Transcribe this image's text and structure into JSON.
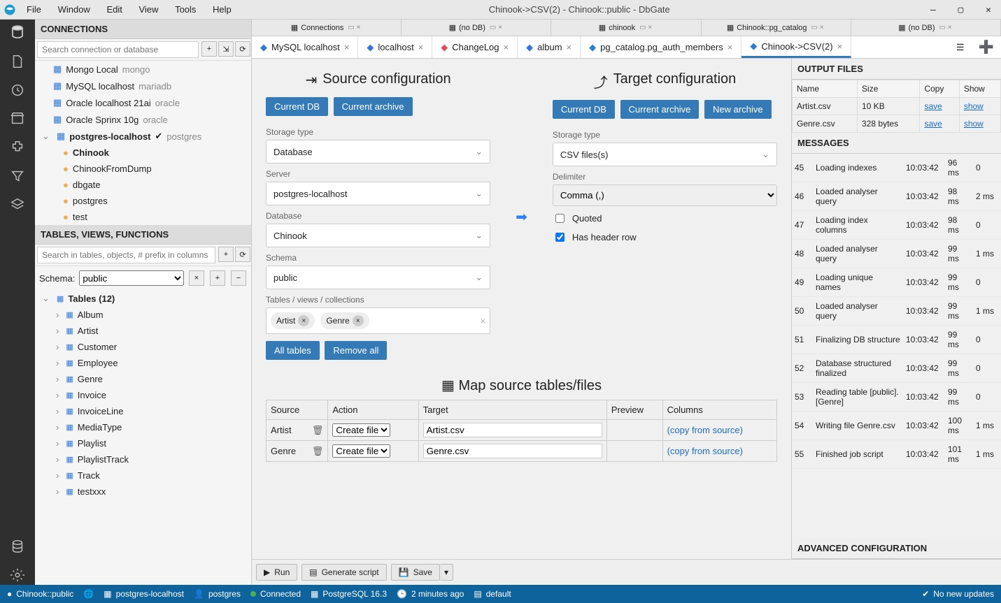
{
  "window": {
    "title": "Chinook->CSV(2) - Chinook::public - DbGate",
    "menu": [
      "File",
      "Window",
      "Edit",
      "View",
      "Tools",
      "Help"
    ]
  },
  "sidebar": {
    "connections_header": "CONNECTIONS",
    "conn_search_placeholder": "Search connection or database",
    "connections": [
      {
        "label": "Mongo Local",
        "engine": "mongo",
        "icon": "db"
      },
      {
        "label": "MySQL localhost",
        "engine": "mariadb",
        "icon": "db"
      },
      {
        "label": "Oracle localhost 21ai",
        "engine": "oracle",
        "icon": "db"
      },
      {
        "label": "Oracle Sprinx 10g",
        "engine": "oracle",
        "icon": "db"
      }
    ],
    "expanded_conn": {
      "label": "postgres-localhost",
      "engine": "postgres",
      "connected": true
    },
    "databases": [
      {
        "label": "Chinook",
        "bold": true
      },
      {
        "label": "ChinookFromDump"
      },
      {
        "label": "dbgate"
      },
      {
        "label": "postgres"
      },
      {
        "label": "test"
      }
    ],
    "tvf_header": "TABLES, VIEWS, FUNCTIONS",
    "tvf_search_placeholder": "Search in tables, objects, # prefix in columns",
    "schema_label": "Schema:",
    "schema_value": "public",
    "tables_header": "Tables (12)",
    "tables": [
      "Album",
      "Artist",
      "Customer",
      "Employee",
      "Genre",
      "Invoice",
      "InvoiceLine",
      "MediaType",
      "Playlist",
      "PlaylistTrack",
      "Track",
      "testxxx"
    ]
  },
  "top_tabs": [
    {
      "label": "Connections",
      "icon": "plug"
    },
    {
      "label": "(no DB)",
      "icon": "db"
    },
    {
      "label": "chinook",
      "icon": "db"
    },
    {
      "label": "Chinook::pg_catalog",
      "icon": "db"
    },
    {
      "label": "(no DB)",
      "icon": "db"
    }
  ],
  "editor_tabs": [
    {
      "label": "MySQL localhost",
      "color": "#2c7ae0",
      "icon": "plug"
    },
    {
      "label": "localhost",
      "color": "#2c7ae0",
      "icon": "plug"
    },
    {
      "label": "ChangeLog",
      "color": "#d9534f",
      "icon": "doc"
    },
    {
      "label": "album",
      "color": "#2c7ae0",
      "icon": "table"
    },
    {
      "label": "pg_catalog.pg_auth_members",
      "color": "#2c7ae0",
      "icon": "table"
    },
    {
      "label": "Chinook->CSV(2)",
      "color": "#2c7ae0",
      "icon": "share",
      "active": true
    }
  ],
  "source": {
    "title": "Source configuration",
    "btn_currentdb": "Current DB",
    "btn_currentarchive": "Current archive",
    "storage_label": "Storage type",
    "storage": "Database",
    "server_label": "Server",
    "server": "postgres-localhost",
    "database_label": "Database",
    "database": "Chinook",
    "schema_label": "Schema",
    "schema": "public",
    "tables_label": "Tables / views / collections",
    "chips": [
      "Artist",
      "Genre"
    ],
    "btn_alltables": "All tables",
    "btn_removeall": "Remove all"
  },
  "target": {
    "title": "Target configuration",
    "btn_currentdb": "Current DB",
    "btn_currentarchive": "Current archive",
    "btn_newarchive": "New archive",
    "storage_label": "Storage type",
    "storage": "CSV files(s)",
    "delimiter_label": "Delimiter",
    "delimiter": "Comma (,)",
    "quoted_label": "Quoted",
    "quoted": false,
    "header_label": "Has header row",
    "header": true
  },
  "map": {
    "title": "Map source tables/files",
    "cols": [
      "Source",
      "Action",
      "Target",
      "Preview",
      "Columns"
    ],
    "action_option": "Create file",
    "copy_text": "(copy from source)",
    "rows": [
      {
        "source": "Artist",
        "target": "Artist.csv"
      },
      {
        "source": "Genre",
        "target": "Genre.csv"
      }
    ]
  },
  "actions": {
    "run": "Run",
    "generate": "Generate script",
    "save": "Save"
  },
  "output": {
    "title": "OUTPUT FILES",
    "cols": {
      "name": "Name",
      "size": "Size",
      "copy": "Copy",
      "show": "Show"
    },
    "rows": [
      {
        "name": "Artist.csv",
        "size": "10 KB",
        "copy": "save",
        "show": "show"
      },
      {
        "name": "Genre.csv",
        "size": "328 bytes",
        "copy": "save",
        "show": "show"
      }
    ]
  },
  "messages": {
    "title": "MESSAGES",
    "rows": [
      {
        "n": "45",
        "msg": "Loading indexes",
        "t": "10:03:42",
        "d": "96 ms",
        "e": "0"
      },
      {
        "n": "46",
        "msg": "Loaded analyser query",
        "t": "10:03:42",
        "d": "98 ms",
        "e": "2 ms"
      },
      {
        "n": "47",
        "msg": "Loading index columns",
        "t": "10:03:42",
        "d": "98 ms",
        "e": "0"
      },
      {
        "n": "48",
        "msg": "Loaded analyser query",
        "t": "10:03:42",
        "d": "99 ms",
        "e": "1 ms"
      },
      {
        "n": "49",
        "msg": "Loading unique names",
        "t": "10:03:42",
        "d": "99 ms",
        "e": "0"
      },
      {
        "n": "50",
        "msg": "Loaded analyser query",
        "t": "10:03:42",
        "d": "99 ms",
        "e": "1 ms"
      },
      {
        "n": "51",
        "msg": "Finalizing DB structure",
        "t": "10:03:42",
        "d": "99 ms",
        "e": "0"
      },
      {
        "n": "52",
        "msg": "Database structured finalized",
        "t": "10:03:42",
        "d": "99 ms",
        "e": "0"
      },
      {
        "n": "53",
        "msg": "Reading table [public].[Genre]",
        "t": "10:03:42",
        "d": "99 ms",
        "e": "0"
      },
      {
        "n": "54",
        "msg": "Writing file Genre.csv",
        "t": "10:03:42",
        "d": "100 ms",
        "e": "1 ms"
      },
      {
        "n": "55",
        "msg": "Finished job script",
        "t": "10:03:42",
        "d": "101 ms",
        "e": "1 ms"
      }
    ]
  },
  "adv_title": "ADVANCED CONFIGURATION",
  "status": {
    "db": "Chinook::public",
    "conn": "postgres-localhost",
    "user": "postgres",
    "state": "Connected",
    "engine": "PostgreSQL 16.3",
    "age": "2 minutes ago",
    "schema": "default",
    "updates": "No new updates"
  }
}
